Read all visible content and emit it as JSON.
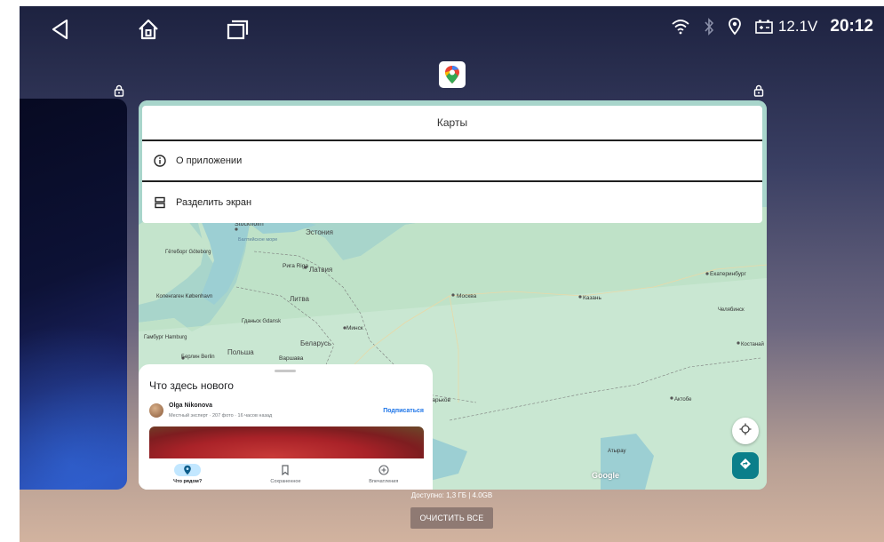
{
  "status_bar": {
    "voltage": "12.1V",
    "time": "20:12",
    "icons": [
      "wifi-icon",
      "bluetooth-icon",
      "location-icon",
      "battery-icon"
    ]
  },
  "navigation": {
    "icons": [
      "back-icon",
      "home-icon",
      "recents-icon"
    ]
  },
  "recent_app": {
    "app_icon": "google-maps-icon",
    "menu": {
      "title": "Карты",
      "items": [
        {
          "label": "О приложении",
          "icon": "info-icon"
        },
        {
          "label": "Разделить экран",
          "icon": "split-screen-icon"
        }
      ]
    },
    "map_labels": [
      {
        "text": "Stockholm"
      },
      {
        "text": "Балтийское море"
      },
      {
        "text": "Эстония"
      },
      {
        "text": "Гётеборг Göteborg"
      },
      {
        "text": "Рига Riga"
      },
      {
        "text": "Латвия"
      },
      {
        "text": "Копенгаген København"
      },
      {
        "text": "Литва"
      },
      {
        "text": "Гданьск Gdansk"
      },
      {
        "text": "Минск"
      },
      {
        "text": "Гамбург Hamburg"
      },
      {
        "text": "Беларусь"
      },
      {
        "text": "Польша"
      },
      {
        "text": "Варшава"
      },
      {
        "text": "Берлин Berlin"
      },
      {
        "text": "Москва"
      },
      {
        "text": "Казань"
      },
      {
        "text": "Екатеринбург"
      },
      {
        "text": "Челябинск"
      },
      {
        "text": "Костанай"
      },
      {
        "text": "Харьков"
      },
      {
        "text": "Актобе"
      },
      {
        "text": "Атырау"
      }
    ],
    "sheet": {
      "title": "Что здесь нового",
      "author": "Olga Nikonova",
      "author_meta": "Местный эксперт · 207 фото · 16 часов назад",
      "follow_label": "Подписаться",
      "tabs": [
        {
          "label": "Что рядом?",
          "icon": "place-icon",
          "active": true
        },
        {
          "label": "Сохраненное",
          "icon": "bookmark-icon",
          "active": false
        },
        {
          "label": "Впечатления",
          "icon": "add-circle-icon",
          "active": false
        }
      ]
    },
    "google_logo": "Google"
  },
  "footer": {
    "memory": "Доступно: 1,3 ГБ | 4.0GB",
    "clear_all": "ОЧИСТИТЬ ВСЕ"
  }
}
